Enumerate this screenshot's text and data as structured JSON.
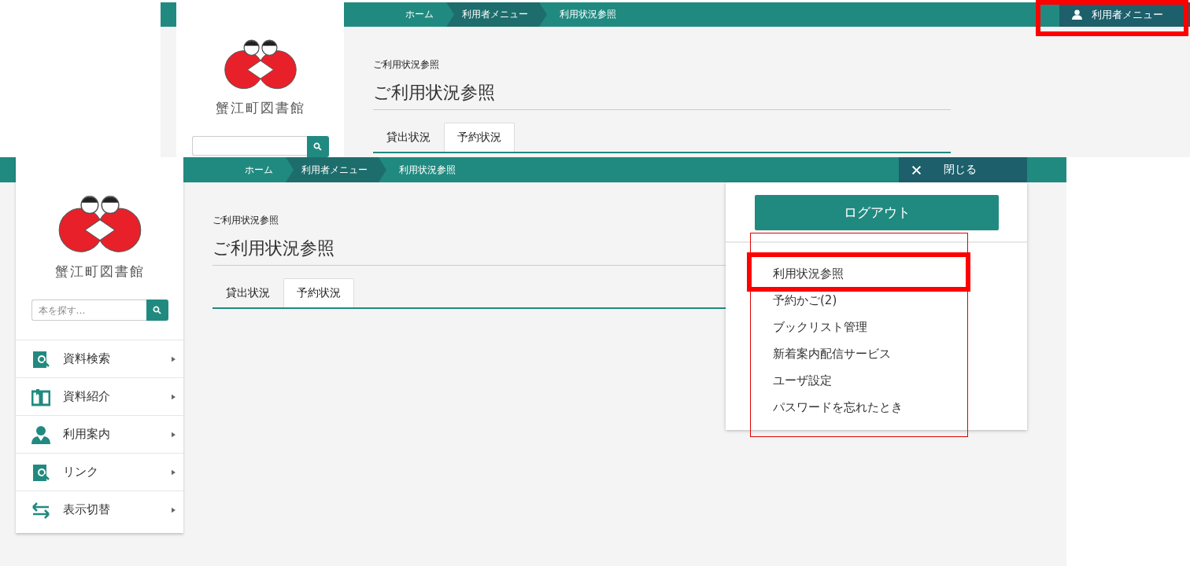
{
  "screenshots": [
    {
      "kind": "upper",
      "breadcrumb": [
        {
          "label": "ホーム",
          "emphasized": false
        },
        {
          "label": "利用者メニュー",
          "emphasized": true
        },
        {
          "label": "利用状況参照",
          "emphasized": false
        }
      ],
      "header_button": {
        "kind": "user",
        "label": "利用者メニュー"
      },
      "library_name": "蟹江町図書館",
      "page": {
        "subtitle": "ご利用状況参照",
        "title": "ご利用状況参照"
      },
      "tabs": [
        {
          "label": "貸出状況",
          "selected": false
        },
        {
          "label": "予約状況",
          "selected": true
        }
      ]
    },
    {
      "kind": "lower",
      "breadcrumb": [
        {
          "label": "ホーム",
          "emphasized": false
        },
        {
          "label": "利用者メニュー",
          "emphasized": true
        },
        {
          "label": "利用状況参照",
          "emphasized": false
        }
      ],
      "header_button": {
        "kind": "close",
        "label": "閉じる"
      },
      "library_name": "蟹江町図書館",
      "search": {
        "placeholder": "本を探す…"
      },
      "sidebar": {
        "items": [
          {
            "kind": "search",
            "label": "資料検索"
          },
          {
            "kind": "book",
            "label": "資料紹介"
          },
          {
            "kind": "person",
            "label": "利用案内"
          },
          {
            "kind": "search",
            "label": "リンク"
          },
          {
            "kind": "swap",
            "label": "表示切替"
          }
        ]
      },
      "page": {
        "subtitle": "ご利用状況参照",
        "title": "ご利用状況参照"
      },
      "tabs": [
        {
          "label": "貸出状況",
          "selected": false
        },
        {
          "label": "予約状況",
          "selected": true
        }
      ],
      "user_menu": {
        "logout": "ログアウト",
        "items": [
          "利用状況参照",
          "予約かご(2)",
          "ブックリスト管理",
          "新着案内配信サービス",
          "ユーザ設定",
          "パスワードを忘れたとき"
        ]
      }
    }
  ],
  "annotations": [
    {
      "kind": "thick"
    },
    {
      "kind": "thin"
    },
    {
      "kind": "thick"
    }
  ]
}
